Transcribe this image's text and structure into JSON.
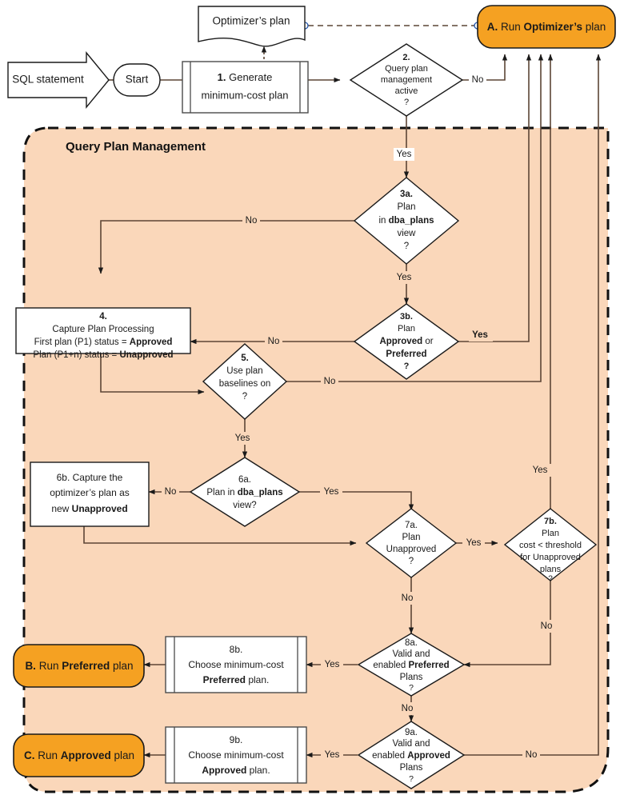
{
  "diagram": {
    "title": "Query Plan Management",
    "container_label": "Query Plan Management",
    "colors": {
      "accent_orange": "#F5A122",
      "container_fill": "#FAD7BA",
      "node_fill": "#FFFFFF",
      "stroke": "#3F3F3F",
      "text": "#1A1A1A"
    }
  },
  "nodes": {
    "input": {
      "id": "input",
      "shape": "arrow-block",
      "label": "SQL statement"
    },
    "start": {
      "id": "start",
      "shape": "rounded",
      "label": "Start"
    },
    "step1": {
      "id": "step1",
      "shape": "predefined-process",
      "label_bold": "1.",
      "label_rest": " Generate",
      "line2": "minimum-cost plan"
    },
    "doc": {
      "id": "optimizer-plan-doc",
      "shape": "document",
      "label": "Optimizer’s plan"
    },
    "A": {
      "id": "A",
      "shape": "terminator-orange",
      "prefix": "A.",
      "mid": " Run ",
      "bold": "Optimizer’s",
      "suffix": " plan"
    },
    "B": {
      "id": "B",
      "shape": "terminator-orange",
      "prefix": "B.",
      "mid": " Run ",
      "bold": "Preferred",
      "suffix": " plan"
    },
    "C": {
      "id": "C",
      "shape": "terminator-orange",
      "prefix": "C.",
      "mid": " Run ",
      "bold": "Approved",
      "suffix": " plan"
    },
    "step2": {
      "id": "step2",
      "shape": "decision",
      "lines": [
        "2.",
        "Query plan",
        "management",
        "active",
        "?"
      ]
    },
    "step3a": {
      "id": "step3a",
      "shape": "decision",
      "lines": [
        "3a.",
        "Plan",
        "in dba_plans",
        "view",
        "?"
      ],
      "bold_lines": [
        0
      ],
      "partial_bold": {
        "2": "dba_plans"
      }
    },
    "step3b": {
      "id": "step3b",
      "shape": "decision",
      "lines": [
        "3b.",
        "Plan",
        "Approved or",
        "Preferred",
        "?"
      ],
      "bold_lines": [
        0,
        3
      ],
      "partial_bold": {
        "2": "Approved"
      }
    },
    "step4": {
      "id": "step4",
      "shape": "process",
      "lines": [
        "4.",
        "Capture Plan Processing",
        "First plan (P1) status = Approved",
        "Plan (P1+n) status = Unapproved"
      ]
    },
    "step5": {
      "id": "step5",
      "shape": "decision",
      "lines": [
        "5.",
        "Use plan",
        "baselines on",
        "?"
      ],
      "bold_lines": [
        0
      ]
    },
    "step6a": {
      "id": "step6a",
      "shape": "decision",
      "lines": [
        "6a.",
        "Plan in dba_plans",
        "view?"
      ]
    },
    "step6b": {
      "id": "step6b",
      "shape": "process",
      "lines": [
        "6b. Capture the",
        "optimizer’s plan as",
        "new Unapproved"
      ]
    },
    "step7a": {
      "id": "step7a",
      "shape": "decision",
      "lines": [
        "7a.",
        "Plan",
        "Unapproved",
        "?"
      ]
    },
    "step7b": {
      "id": "step7b",
      "shape": "decision",
      "lines": [
        "7b.",
        "Plan",
        "cost < threshold",
        "for Unapproved",
        "plans",
        "?"
      ],
      "bold_lines": [
        0
      ]
    },
    "step8a": {
      "id": "step8a",
      "shape": "decision",
      "lines": [
        "8a.",
        "Valid and",
        "enabled Preferred",
        "Plans",
        "?"
      ]
    },
    "step8b": {
      "id": "step8b",
      "shape": "predefined-process",
      "lines": [
        "8b.",
        "Choose minimum-cost",
        "Preferred plan."
      ]
    },
    "step9a": {
      "id": "step9a",
      "shape": "decision",
      "lines": [
        "9a.",
        "Valid and",
        "enabled Approved",
        "Plans",
        "?"
      ]
    },
    "step9b": {
      "id": "step9b",
      "shape": "predefined-process",
      "lines": [
        "9b.",
        "Choose minimum-cost",
        "Approved plan."
      ]
    }
  },
  "edge_labels": {
    "e2_no": "No",
    "e3a_no": "No",
    "e3a_yes": "Yes",
    "e2_yes": "Yes",
    "e3b_no": "No",
    "e3b_yes": "Yes",
    "e5_no": "No",
    "e5_yes": "Yes",
    "e6a_no": "No",
    "e6a_yes": "Yes",
    "e7a_yes": "Yes",
    "e7a_no": "No",
    "e7b_yes": "Yes",
    "e7b_no": "No",
    "e8a_yes": "Yes",
    "e8a_no": "No",
    "e9a_yes": "Yes",
    "e9a_no": "No"
  }
}
